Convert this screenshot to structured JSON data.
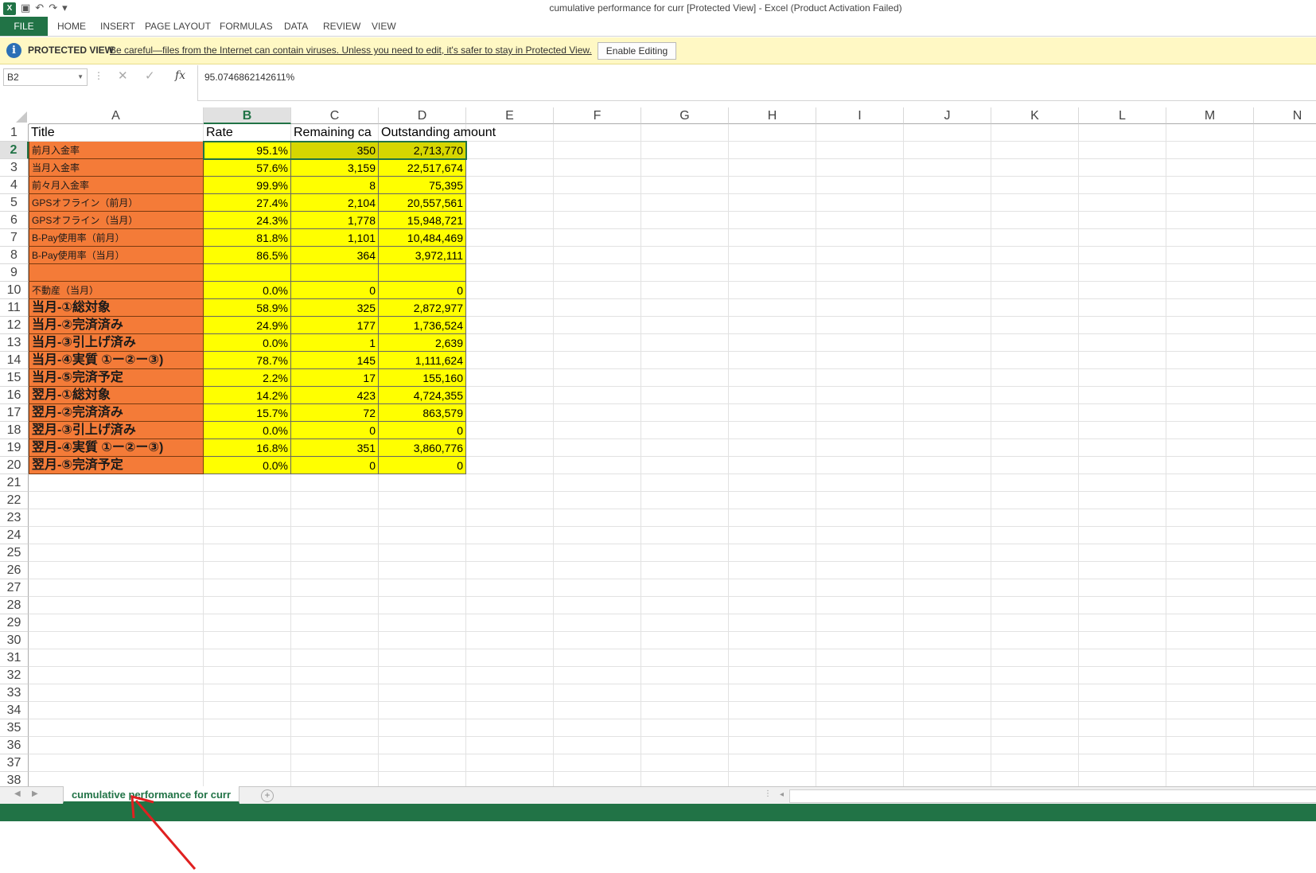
{
  "window": {
    "title": "cumulative performance for curr  [Protected View] - Excel (Product Activation Failed)",
    "app_icon": "X"
  },
  "ribbon": {
    "tabs": [
      "FILE",
      "HOME",
      "INSERT",
      "PAGE LAYOUT",
      "FORMULAS",
      "DATA",
      "REVIEW",
      "VIEW"
    ]
  },
  "protected_view": {
    "title": "PROTECTED VIEW",
    "message": "Be careful—files from the Internet can contain viruses. Unless you need to edit, it's safer to stay in Protected View.",
    "button": "Enable Editing"
  },
  "formula_bar": {
    "name_box": "B2",
    "fx": "fx",
    "value": "95.0746862142611%"
  },
  "columns": [
    "A",
    "B",
    "C",
    "D",
    "E",
    "F",
    "G",
    "H",
    "I",
    "J",
    "K",
    "L",
    "M",
    "N"
  ],
  "selected": {
    "col": "B",
    "row": "2"
  },
  "rows": [
    "1",
    "2",
    "3",
    "4",
    "5",
    "6",
    "7",
    "8",
    "9",
    "10",
    "11",
    "12",
    "13",
    "14",
    "15",
    "16",
    "17",
    "18",
    "19",
    "20",
    "21",
    "22",
    "23",
    "24",
    "25",
    "26",
    "27",
    "28",
    "29",
    "30",
    "31",
    "32",
    "33",
    "34",
    "35",
    "36",
    "37",
    "38"
  ],
  "headers": {
    "a": "Title",
    "b": "Rate",
    "c": "Remaining ca",
    "d": "Outstanding amount"
  },
  "data_rows": [
    {
      "title": "前月入金率",
      "rate": "95.1%",
      "remaining": "350",
      "amount": "2,713,770",
      "style": "small"
    },
    {
      "title": "当月入金率",
      "rate": "57.6%",
      "remaining": "3,159",
      "amount": "22,517,674",
      "style": "small"
    },
    {
      "title": "前々月入金率",
      "rate": "99.9%",
      "remaining": "8",
      "amount": "75,395",
      "style": "small"
    },
    {
      "title": "GPSオフライン（前月）",
      "rate": "27.4%",
      "remaining": "2,104",
      "amount": "20,557,561",
      "style": "small"
    },
    {
      "title": "GPSオフライン（当月）",
      "rate": "24.3%",
      "remaining": "1,778",
      "amount": "15,948,721",
      "style": "small"
    },
    {
      "title": "B-Pay使用率（前月）",
      "rate": "81.8%",
      "remaining": "1,101",
      "amount": "10,484,469",
      "style": "small"
    },
    {
      "title": "B-Pay使用率（当月）",
      "rate": "86.5%",
      "remaining": "364",
      "amount": "3,972,111",
      "style": "small"
    },
    {
      "title": "",
      "rate": "",
      "remaining": "",
      "amount": "",
      "style": "small"
    },
    {
      "title": "不動産（当月）",
      "rate": "0.0%",
      "remaining": "0",
      "amount": "0",
      "style": "small"
    },
    {
      "title": "当月-①総対象",
      "rate": "58.9%",
      "remaining": "325",
      "amount": "2,872,977",
      "style": "big"
    },
    {
      "title": "当月-②完済済み",
      "rate": "24.9%",
      "remaining": "177",
      "amount": "1,736,524",
      "style": "big"
    },
    {
      "title": "当月-③引上げ済み",
      "rate": "0.0%",
      "remaining": "1",
      "amount": "2,639",
      "style": "big"
    },
    {
      "title": "当月-④実質 ①ー②ー③)",
      "rate": "78.7%",
      "remaining": "145",
      "amount": "1,111,624",
      "style": "big"
    },
    {
      "title": "当月-⑤完済予定",
      "rate": "2.2%",
      "remaining": "17",
      "amount": "155,160",
      "style": "big"
    },
    {
      "title": "翌月-①総対象",
      "rate": "14.2%",
      "remaining": "423",
      "amount": "4,724,355",
      "style": "big"
    },
    {
      "title": "翌月-②完済済み",
      "rate": "15.7%",
      "remaining": "72",
      "amount": "863,579",
      "style": "big"
    },
    {
      "title": "翌月-③引上げ済み",
      "rate": "0.0%",
      "remaining": "0",
      "amount": "0",
      "style": "big"
    },
    {
      "title": "翌月-④実質 ①ー②ー③)",
      "rate": "16.8%",
      "remaining": "351",
      "amount": "3,860,776",
      "style": "big"
    },
    {
      "title": "翌月-⑤完済予定",
      "rate": "0.0%",
      "remaining": "0",
      "amount": "0",
      "style": "big"
    }
  ],
  "sheet_tabs": [
    "cumulative performance for curr"
  ],
  "colors": {
    "accent": "#217346",
    "title_fill": "#f47b38",
    "value_fill": "#ffff00",
    "annotation_arrow": "#e02020"
  }
}
